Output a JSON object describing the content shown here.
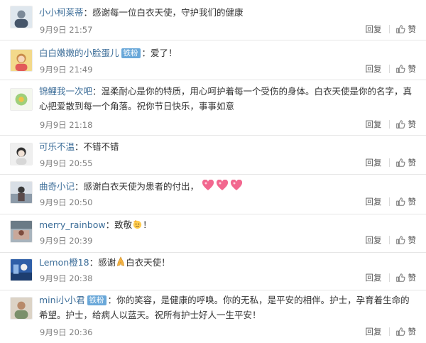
{
  "labels": {
    "reply": "回复",
    "like": "赞"
  },
  "comments": [
    {
      "username": "小小柯莱蒂",
      "badge": "",
      "colon": "：",
      "text": "感谢每一位白衣天使，守护我们的健康",
      "time": "9月9日 21:57"
    },
    {
      "username": "白白嫩嫩的小脸蛋儿",
      "badge": "铁粉",
      "colon": "：",
      "text": "爱了！",
      "time": "9月9日 21:49"
    },
    {
      "username": "锦鲤我一次吧",
      "badge": "",
      "colon": "：",
      "text": "温柔耐心是你的特质，用心呵护着每一个受伤的身体。白衣天使是你的名字，真心把爱散到每一个角落。祝你节日快乐，事事如意",
      "time": "9月9日 21:18"
    },
    {
      "username": "可乐不温",
      "badge": "",
      "colon": "：",
      "text": "不错不错",
      "time": "9月9日 20:55"
    },
    {
      "username": "曲奇小记",
      "badge": "",
      "colon": "：",
      "text": "感谢白衣天使为患者的付出，",
      "time": "9月9日 20:50"
    },
    {
      "username": "merry_rainbow",
      "badge": "",
      "colon": "：",
      "text": "致敬",
      "text2": "！",
      "time": "9月9日 20:39"
    },
    {
      "username": "Lemon橙18",
      "badge": "",
      "colon": "：",
      "text": "感谢",
      "text2": "白衣天使！",
      "time": "9月9日 20:38"
    },
    {
      "username": "mini小小君",
      "badge": "铁粉",
      "colon": "：",
      "text": "你的笑容，是健康的呼唤。你的无私，是平安的相伴。护士，孕育着生命的希望。护士，给病人以蓝天。祝所有护士好人一生平安！",
      "time": "9月9日 20:36"
    }
  ],
  "badge_color": "#6aa8d9",
  "username_color": "#3d6e99"
}
